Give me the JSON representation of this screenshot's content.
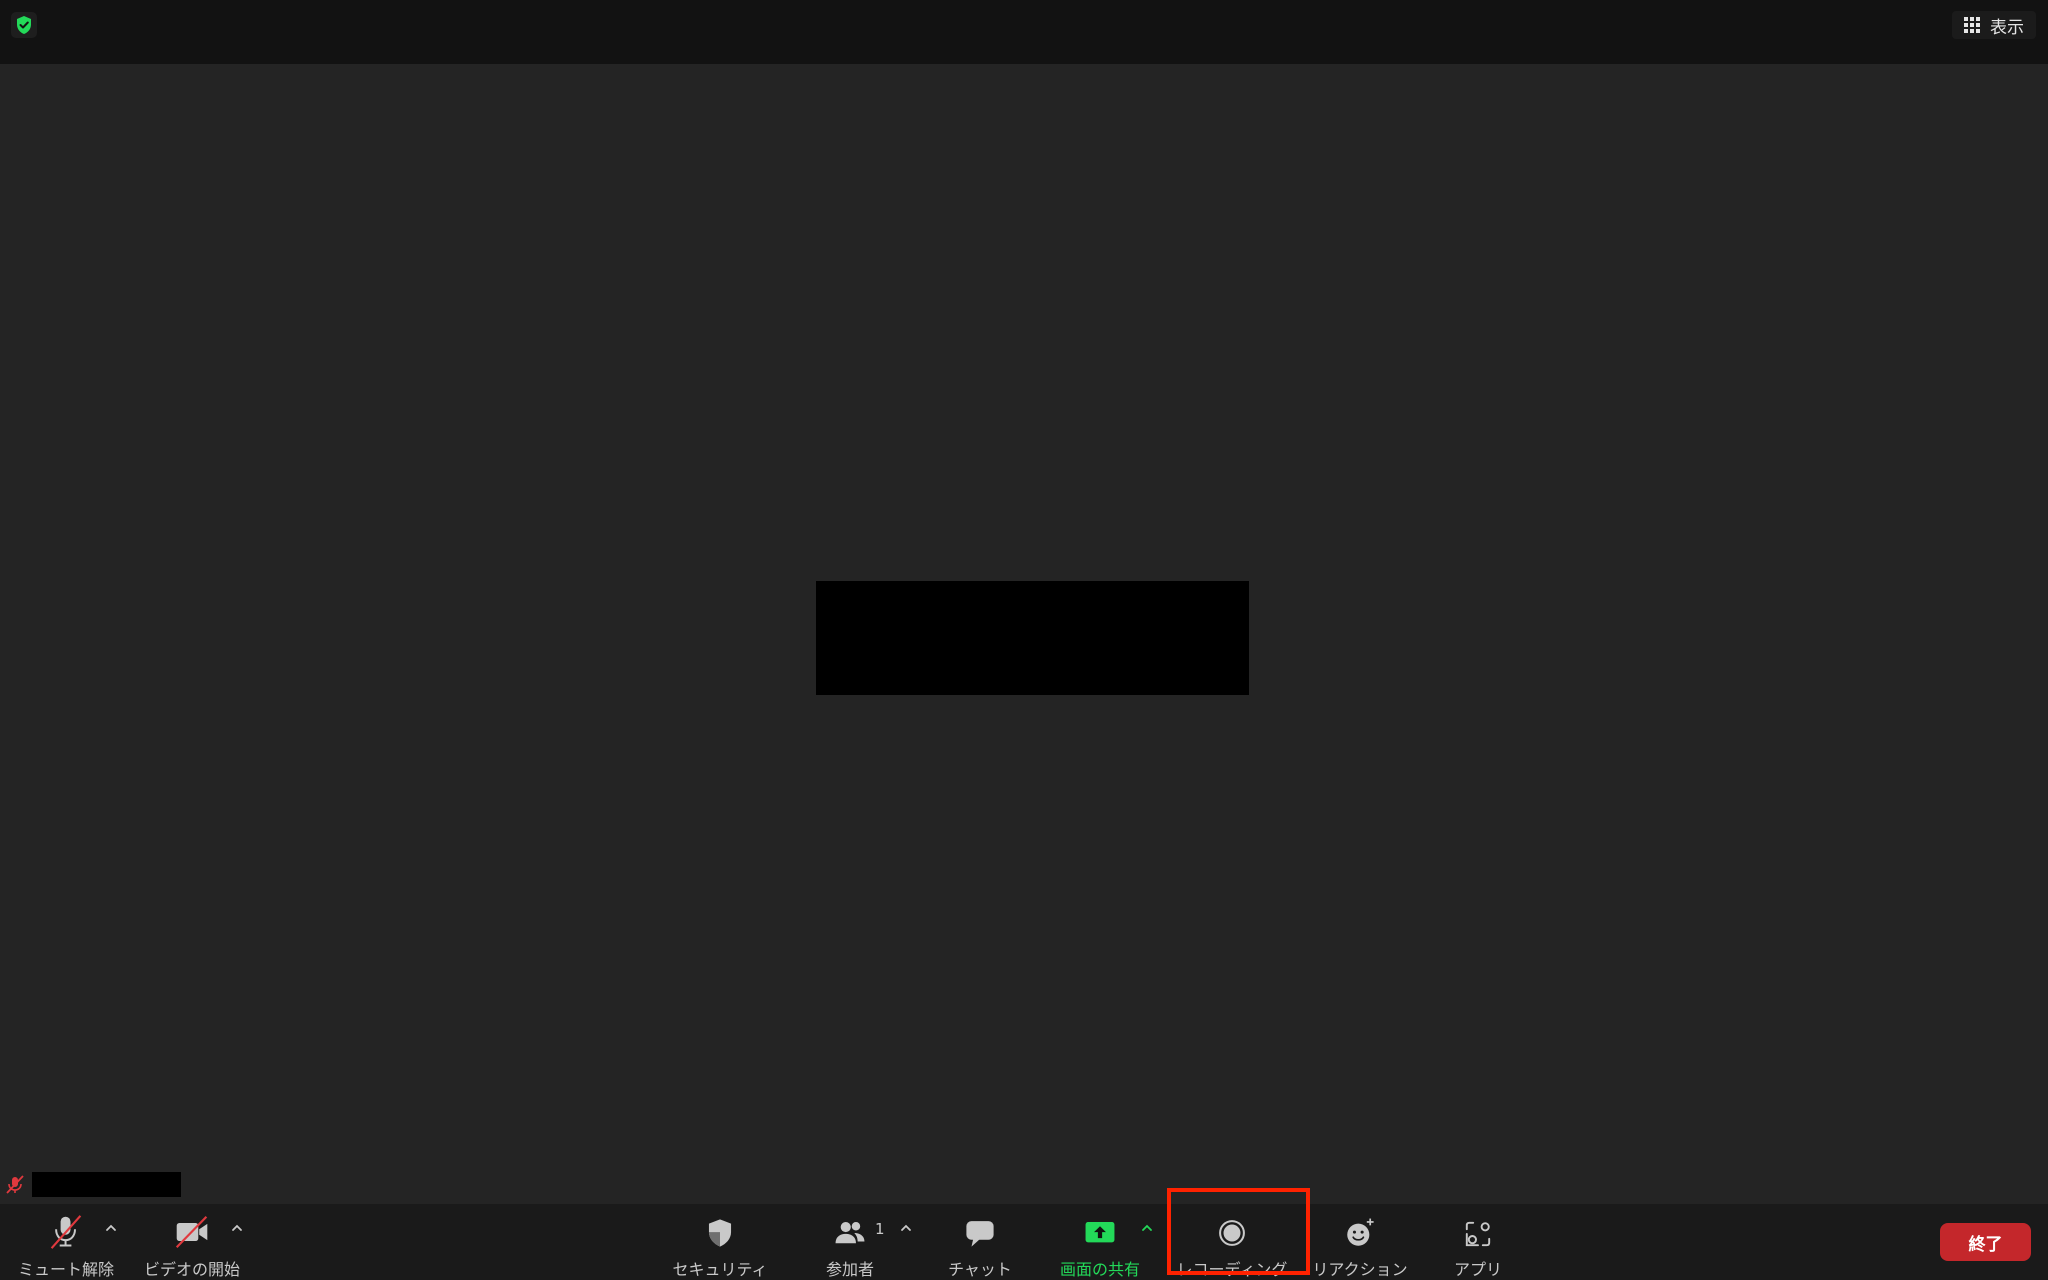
{
  "topbar": {
    "view_label": "表示"
  },
  "toolbar": {
    "unmute_label": "ミュート解除",
    "start_video_label": "ビデオの開始",
    "security_label": "セキュリティ",
    "participants_label": "参加者",
    "participants_count": "1",
    "chat_label": "チャット",
    "share_screen_label": "画面の共有",
    "recording_label": "レコーディング",
    "reactions_label": "リアクション",
    "apps_label": "アプリ",
    "end_label": "終了"
  },
  "colors": {
    "share_green": "#23d959",
    "end_red": "#c4272b",
    "highlight_red": "#ff2200",
    "muted_red": "#e0393e"
  }
}
